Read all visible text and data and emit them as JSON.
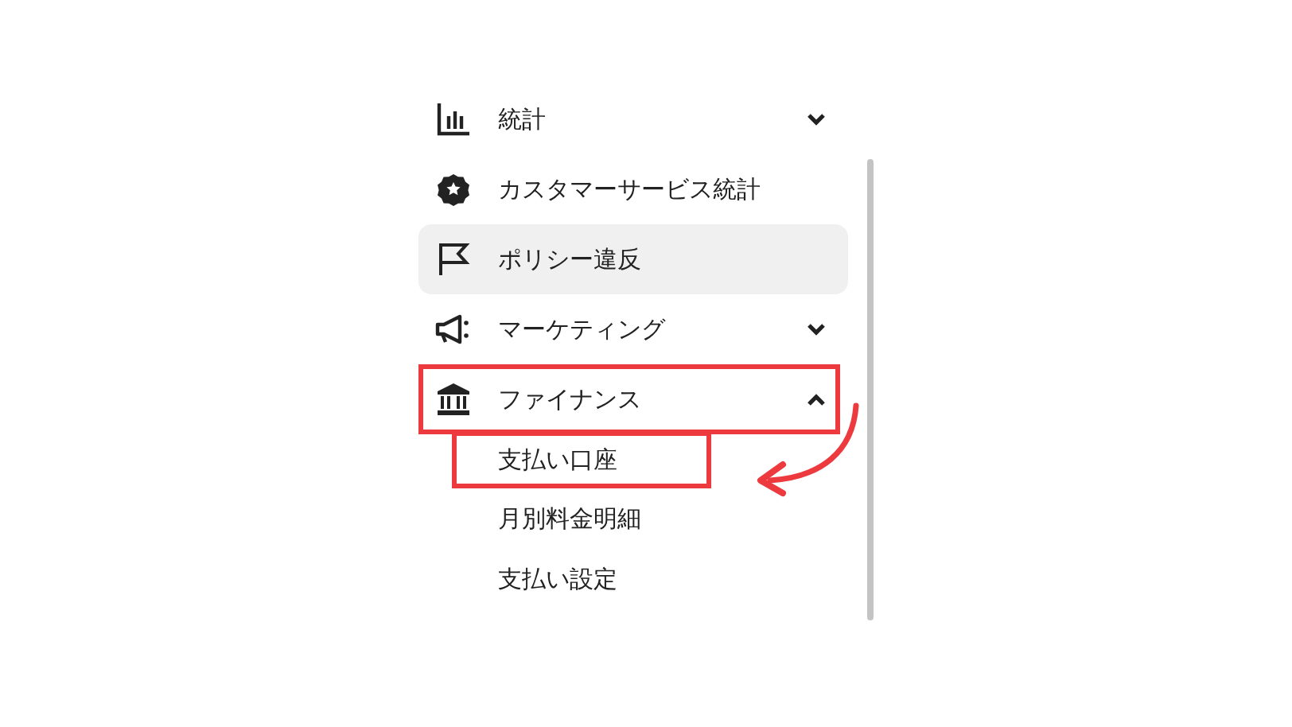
{
  "menu": {
    "items": [
      {
        "label": "統計",
        "selected": false,
        "expanded": false,
        "annotated": false
      },
      {
        "label": "カスタマーサービス統計",
        "selected": false,
        "annotated": false
      },
      {
        "label": "ポリシー違反",
        "selected": true,
        "annotated": false
      },
      {
        "label": "マーケティング",
        "selected": false,
        "expanded": false,
        "annotated": false
      },
      {
        "label": "ファイナンス",
        "selected": false,
        "expanded": true,
        "annotated": true,
        "children": [
          {
            "label": "支払い口座",
            "annotated": true
          },
          {
            "label": "月別料金明細",
            "annotated": false
          },
          {
            "label": "支払い設定",
            "annotated": false
          }
        ]
      }
    ]
  }
}
